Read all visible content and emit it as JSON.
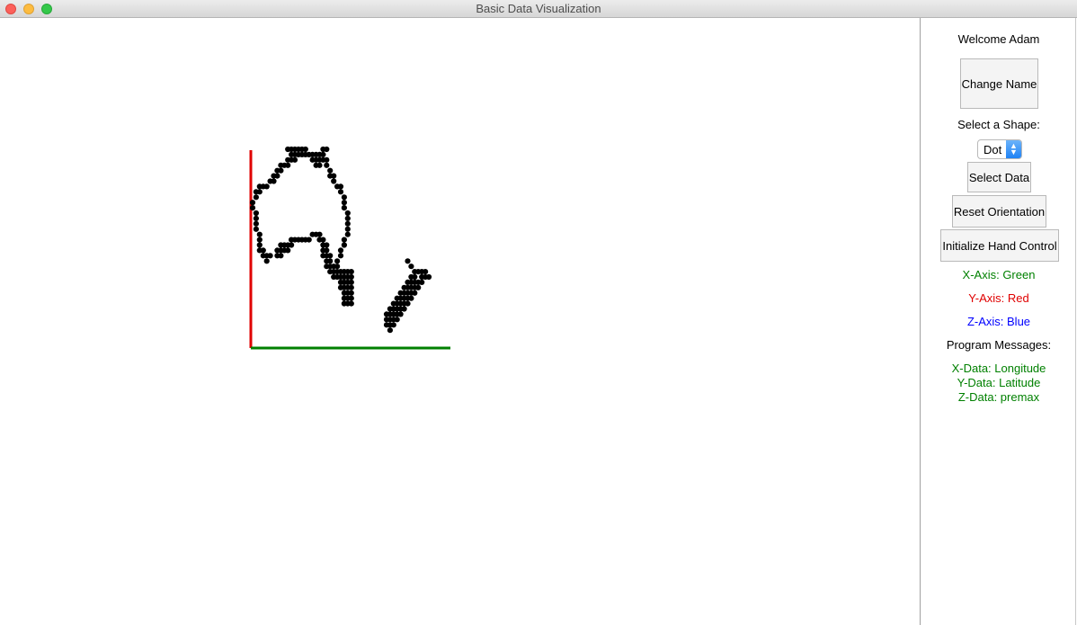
{
  "window": {
    "title": "Basic Data Visualization"
  },
  "panel": {
    "welcome": "Welcome Adam",
    "change_name": "Change Name",
    "select_shape_label": "Select a Shape:",
    "shape": {
      "selected": "Dot"
    },
    "select_data": "Select Data",
    "reset_orientation": "Reset Orientation",
    "init_hand_control": "Initialize Hand Control",
    "x_axis": "X-Axis: Green",
    "y_axis": "Y-Axis: Red",
    "z_axis": "Z-Axis: Blue",
    "program_messages": "Program Messages:",
    "messages": [
      "X-Data: Longitude",
      "Y-Data: Latitude",
      "Z-Data: premax"
    ]
  },
  "colors": {
    "x_axis": "#008000",
    "y_axis": "#e00000",
    "z_axis": "#0000ff",
    "messages": "#008000",
    "dots": "#000000"
  },
  "chart_data": {
    "type": "scatter",
    "xlabel": "",
    "ylabel": "",
    "points": [
      [
        118,
        -11
      ],
      [
        119,
        -11
      ],
      [
        120,
        -11
      ],
      [
        121,
        -11
      ],
      [
        122,
        -11
      ],
      [
        123,
        -11
      ],
      [
        128,
        -12
      ],
      [
        121,
        -12
      ],
      [
        124,
        -12
      ],
      [
        125,
        -12
      ],
      [
        126,
        -12
      ],
      [
        127,
        -12
      ],
      [
        128,
        -11
      ],
      [
        129,
        -11
      ],
      [
        119,
        -12
      ],
      [
        120,
        -12
      ],
      [
        122,
        -12
      ],
      [
        123,
        -12
      ],
      [
        128,
        -13
      ],
      [
        129,
        -13
      ],
      [
        118,
        -13
      ],
      [
        119,
        -13
      ],
      [
        120,
        -13
      ],
      [
        125,
        -13
      ],
      [
        126,
        -13
      ],
      [
        127,
        -13
      ],
      [
        129,
        -14
      ],
      [
        116,
        -14
      ],
      [
        117,
        -14
      ],
      [
        118,
        -14
      ],
      [
        126,
        -14
      ],
      [
        127,
        -14
      ],
      [
        130,
        -15
      ],
      [
        115,
        -15
      ],
      [
        116,
        -15
      ],
      [
        130,
        -16
      ],
      [
        131,
        -16
      ],
      [
        114,
        -16
      ],
      [
        115,
        -16
      ],
      [
        131,
        -17
      ],
      [
        113,
        -17
      ],
      [
        114,
        -17
      ],
      [
        132,
        -18
      ],
      [
        133,
        -18
      ],
      [
        110,
        -18
      ],
      [
        111,
        -18
      ],
      [
        112,
        -18
      ],
      [
        133,
        -19
      ],
      [
        109,
        -19
      ],
      [
        110,
        -19
      ],
      [
        134,
        -20
      ],
      [
        109,
        -20
      ],
      [
        134,
        -21
      ],
      [
        108,
        -21
      ],
      [
        134,
        -22
      ],
      [
        108,
        -22
      ],
      [
        135,
        -23
      ],
      [
        109,
        -23
      ],
      [
        135,
        -24
      ],
      [
        109,
        -24
      ],
      [
        135,
        -25
      ],
      [
        109,
        -25
      ],
      [
        135,
        -26
      ],
      [
        109,
        -26
      ],
      [
        135,
        -27
      ],
      [
        110,
        -27
      ],
      [
        134,
        -28
      ],
      [
        110,
        -28
      ],
      [
        125,
        -27
      ],
      [
        126,
        -27
      ],
      [
        127,
        -27
      ],
      [
        134,
        -29
      ],
      [
        110,
        -29
      ],
      [
        119,
        -28
      ],
      [
        120,
        -28
      ],
      [
        121,
        -28
      ],
      [
        122,
        -28
      ],
      [
        123,
        -28
      ],
      [
        124,
        -28
      ],
      [
        127,
        -28
      ],
      [
        128,
        -28
      ],
      [
        133,
        -30
      ],
      [
        110,
        -30
      ],
      [
        111,
        -30
      ],
      [
        116,
        -29
      ],
      [
        117,
        -29
      ],
      [
        118,
        -29
      ],
      [
        119,
        -29
      ],
      [
        128,
        -29
      ],
      [
        129,
        -29
      ],
      [
        133,
        -31
      ],
      [
        111,
        -31
      ],
      [
        112,
        -31
      ],
      [
        113,
        -31
      ],
      [
        115,
        -30
      ],
      [
        116,
        -30
      ],
      [
        117,
        -30
      ],
      [
        118,
        -30
      ],
      [
        128,
        -30
      ],
      [
        129,
        -30
      ],
      [
        132,
        -32
      ],
      [
        112,
        -32
      ],
      [
        115,
        -31
      ],
      [
        116,
        -31
      ],
      [
        128,
        -31
      ],
      [
        129,
        -31
      ],
      [
        130,
        -31
      ],
      [
        132,
        -33
      ],
      [
        129,
        -32
      ],
      [
        130,
        -32
      ],
      [
        131,
        -33
      ],
      [
        129,
        -33
      ],
      [
        130,
        -33
      ],
      [
        130,
        -34
      ],
      [
        131,
        -34
      ],
      [
        132,
        -34
      ],
      [
        133,
        -34
      ],
      [
        134,
        -34
      ],
      [
        135,
        -34
      ],
      [
        136,
        -34
      ],
      [
        131,
        -35
      ],
      [
        132,
        -35
      ],
      [
        133,
        -35
      ],
      [
        134,
        -35
      ],
      [
        135,
        -35
      ],
      [
        136,
        -35
      ],
      [
        133,
        -36
      ],
      [
        134,
        -36
      ],
      [
        135,
        -36
      ],
      [
        136,
        -36
      ],
      [
        133,
        -37
      ],
      [
        134,
        -37
      ],
      [
        135,
        -37
      ],
      [
        136,
        -37
      ],
      [
        134,
        -38
      ],
      [
        135,
        -38
      ],
      [
        136,
        -38
      ],
      [
        134,
        -39
      ],
      [
        135,
        -39
      ],
      [
        136,
        -39
      ],
      [
        134,
        -40
      ],
      [
        135,
        -40
      ],
      [
        136,
        -40
      ],
      [
        152,
        -32
      ],
      [
        153,
        -33
      ],
      [
        154,
        -34
      ],
      [
        155,
        -34
      ],
      [
        156,
        -34
      ],
      [
        157,
        -34
      ],
      [
        153,
        -35
      ],
      [
        154,
        -35
      ],
      [
        156,
        -35
      ],
      [
        157,
        -35
      ],
      [
        158,
        -35
      ],
      [
        152,
        -36
      ],
      [
        153,
        -36
      ],
      [
        154,
        -36
      ],
      [
        155,
        -36
      ],
      [
        156,
        -36
      ],
      [
        151,
        -37
      ],
      [
        152,
        -37
      ],
      [
        153,
        -37
      ],
      [
        154,
        -37
      ],
      [
        155,
        -37
      ],
      [
        150,
        -38
      ],
      [
        151,
        -38
      ],
      [
        152,
        -38
      ],
      [
        153,
        -38
      ],
      [
        154,
        -38
      ],
      [
        149,
        -39
      ],
      [
        150,
        -39
      ],
      [
        151,
        -39
      ],
      [
        152,
        -39
      ],
      [
        153,
        -39
      ],
      [
        148,
        -40
      ],
      [
        149,
        -40
      ],
      [
        150,
        -40
      ],
      [
        151,
        -40
      ],
      [
        152,
        -40
      ],
      [
        147,
        -41
      ],
      [
        148,
        -41
      ],
      [
        149,
        -41
      ],
      [
        150,
        -41
      ],
      [
        151,
        -41
      ],
      [
        146,
        -42
      ],
      [
        147,
        -42
      ],
      [
        148,
        -42
      ],
      [
        149,
        -42
      ],
      [
        150,
        -42
      ],
      [
        146,
        -43
      ],
      [
        147,
        -43
      ],
      [
        148,
        -43
      ],
      [
        149,
        -43
      ],
      [
        146,
        -44
      ],
      [
        147,
        -44
      ],
      [
        148,
        -44
      ],
      [
        147,
        -45
      ]
    ]
  }
}
